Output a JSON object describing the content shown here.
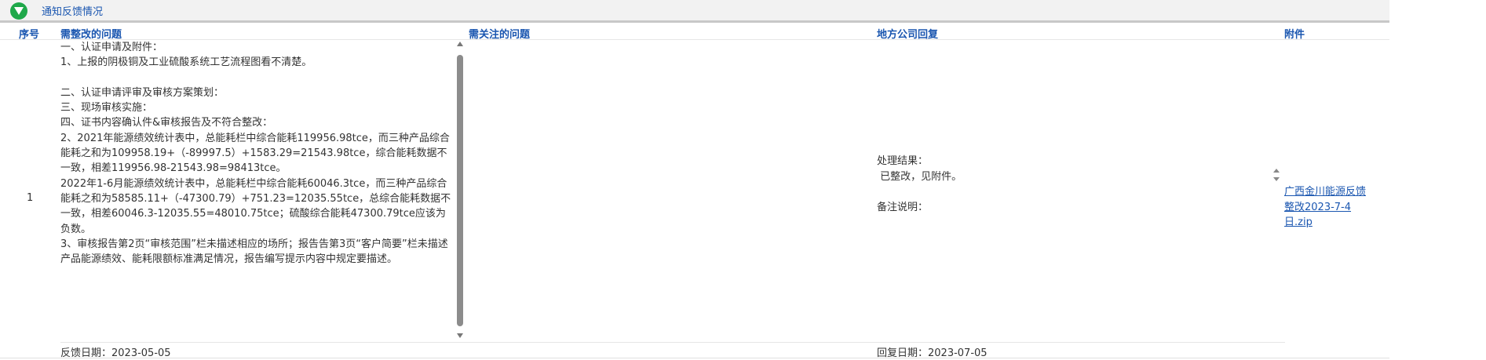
{
  "section": {
    "title": "通知反馈情况"
  },
  "table": {
    "headers": {
      "seq": "序号",
      "issues": "需整改的问题",
      "concerns": "需关注的问题",
      "reply": "地方公司回复",
      "attachment": "附件"
    },
    "rows": [
      {
        "seq": "1",
        "issues": "一、认证申请及附件：\n1、上报的阴极铜及工业硫酸系统工艺流程图看不清楚。\n\n二、认证申请评审及审核方案策划：\n三、现场审核实施：\n四、证书内容确认件&审核报告及不符合整改：\n2、2021年能源绩效统计表中，总能耗栏中综合能耗119956.98tce，而三种产品综合能耗之和为109958.19+（-89997.5）+1583.29=21543.98tce，综合能耗数据不一致，相差119956.98-21543.98=98413tce。\n2022年1-6月能源绩效统计表中，总能耗栏中综合能耗60046.3tce，而三种产品综合能耗之和为58585.11+（-47300.79）+751.23=12035.55tce，总综合能耗数据不一致，相差60046.3-12035.55=48010.75tce；硫酸综合能耗47300.79tce应该为负数。\n3、审核报告第2页“审核范围”栏未描述相应的场所；报告告第3页“客户简要”栏未描述产品能源绩效、能耗限额标准满足情况，报告编写提示内容中规定要描述。",
        "concerns": "",
        "reply": "处理结果：\n 已整改，见附件。\n\n备注说明：",
        "attachment": "广西金川能源反馈整改2023-7-4日.zip",
        "feedback_date": "反馈日期：2023-05-05",
        "reply_date": "回复日期：2023-07-05"
      }
    ]
  },
  "colors": {
    "accent": "#1a56b0",
    "toggle": "#1fa84a"
  }
}
